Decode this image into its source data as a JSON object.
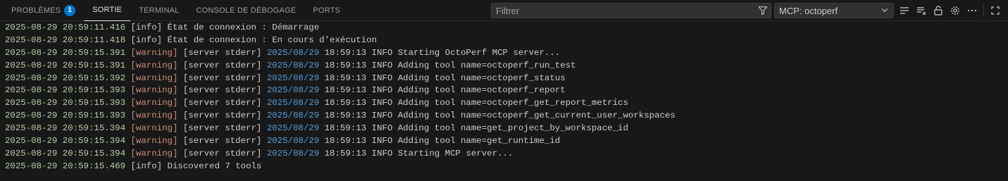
{
  "tabs": [
    {
      "label": "PROBLÈMES",
      "badge": "1",
      "active": false
    },
    {
      "label": "SORTIE",
      "active": true
    },
    {
      "label": "TERMINAL",
      "active": false
    },
    {
      "label": "CONSOLE DE DÉBOGAGE",
      "active": false
    },
    {
      "label": "PORTS",
      "active": false
    }
  ],
  "filter": {
    "placeholder": "Filtrer",
    "value": ""
  },
  "channel_select": {
    "value": "MCP: octoperf"
  },
  "toolbar_icons": [
    "filter-icon",
    "word-wrap-icon",
    "clear-icon",
    "lock-icon",
    "gear-icon",
    "more-icon",
    "maximize-icon",
    "close-icon"
  ],
  "log_lines": [
    {
      "timestamp": "2025-08-29 20:59:11.416",
      "level": "[info]",
      "message": "État de connexion : Démarrage"
    },
    {
      "timestamp": "2025-08-29 20:59:11.418",
      "level": "[info]",
      "message": "État de connexion : En cours d'exécution"
    },
    {
      "timestamp": "2025-08-29 20:59:15.391",
      "level": "[warning]",
      "source": "[server stderr]",
      "date": "2025/08/29",
      "time": "18:59:13",
      "message": "INFO Starting OctoPerf MCP server..."
    },
    {
      "timestamp": "2025-08-29 20:59:15.391",
      "level": "[warning]",
      "source": "[server stderr]",
      "date": "2025/08/29",
      "time": "18:59:13",
      "message": "INFO Adding tool name=octoperf_run_test"
    },
    {
      "timestamp": "2025-08-29 20:59:15.392",
      "level": "[warning]",
      "source": "[server stderr]",
      "date": "2025/08/29",
      "time": "18:59:13",
      "message": "INFO Adding tool name=octoperf_status"
    },
    {
      "timestamp": "2025-08-29 20:59:15.393",
      "level": "[warning]",
      "source": "[server stderr]",
      "date": "2025/08/29",
      "time": "18:59:13",
      "message": "INFO Adding tool name=octoperf_report"
    },
    {
      "timestamp": "2025-08-29 20:59:15.393",
      "level": "[warning]",
      "source": "[server stderr]",
      "date": "2025/08/29",
      "time": "18:59:13",
      "message": "INFO Adding tool name=octoperf_get_report_metrics"
    },
    {
      "timestamp": "2025-08-29 20:59:15.393",
      "level": "[warning]",
      "source": "[server stderr]",
      "date": "2025/08/29",
      "time": "18:59:13",
      "message": "INFO Adding tool name=octoperf_get_current_user_workspaces"
    },
    {
      "timestamp": "2025-08-29 20:59:15.394",
      "level": "[warning]",
      "source": "[server stderr]",
      "date": "2025/08/29",
      "time": "18:59:13",
      "message": "INFO Adding tool name=get_project_by_workspace_id"
    },
    {
      "timestamp": "2025-08-29 20:59:15.394",
      "level": "[warning]",
      "source": "[server stderr]",
      "date": "2025/08/29",
      "time": "18:59:13",
      "message": "INFO Adding tool name=get_runtime_id"
    },
    {
      "timestamp": "2025-08-29 20:59:15.394",
      "level": "[warning]",
      "source": "[server stderr]",
      "date": "2025/08/29",
      "time": "18:59:13",
      "message": "INFO Starting MCP server..."
    },
    {
      "timestamp": "2025-08-29 20:59:15.469",
      "level": "[info]",
      "message": "Discovered 7 tools"
    }
  ]
}
